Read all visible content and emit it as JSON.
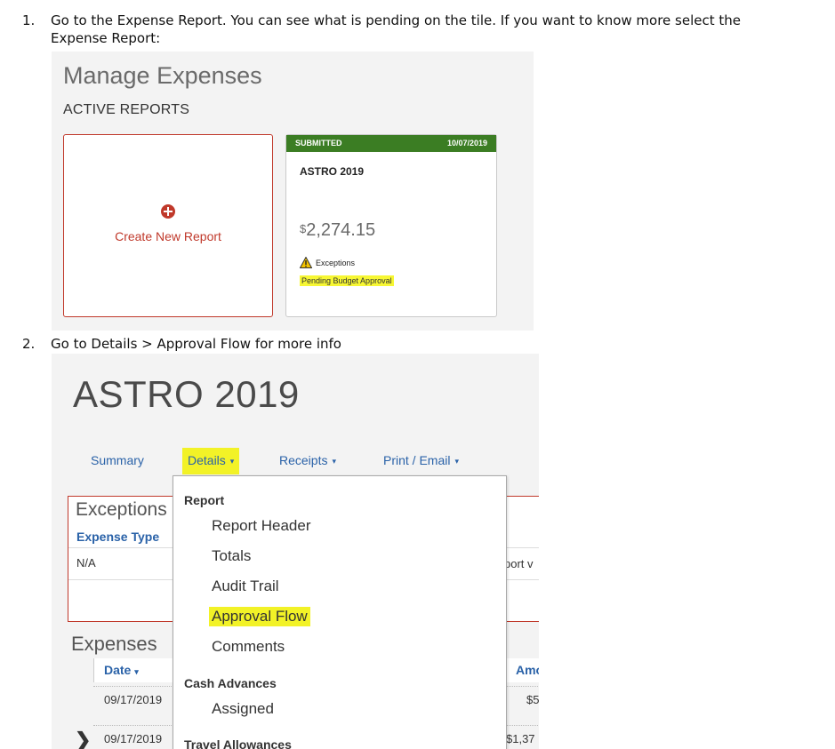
{
  "steps": [
    {
      "num": "1.",
      "text": "Go to the Expense Report. You can see what is pending on the tile. If you want to know more select the",
      "text2": "Expense Report:"
    },
    {
      "num": "2.",
      "text": "Go to Details > Approval Flow for more info"
    }
  ],
  "panel1": {
    "title": "Manage Expenses",
    "subtitle": "ACTIVE REPORTS",
    "create_label": "Create New Report",
    "tile": {
      "status": "SUBMITTED",
      "date": "10/07/2019",
      "name": "ASTRO 2019",
      "currency": "$",
      "amount": "2,274.15",
      "exceptions": "Exceptions",
      "pending": "Pending Budget Approval"
    }
  },
  "panel2": {
    "title": "ASTRO 2019",
    "nav": {
      "summary": "Summary",
      "details": "Details",
      "receipts": "Receipts",
      "print": "Print / Email",
      "caret": "▾"
    },
    "exceptions": {
      "title": "Exceptions",
      "column": "Expense Type",
      "cell": "N/A",
      "right_text": "port v"
    },
    "expenses": {
      "title": "Expenses",
      "col_date": "Date",
      "col_amount": "Amo",
      "rows": [
        {
          "date": "09/17/2019",
          "amount": "$5"
        },
        {
          "date": "09/17/2019",
          "amount": "$1,37"
        }
      ]
    },
    "dropdown": {
      "report_head": "Report",
      "items": [
        "Report Header",
        "Totals",
        "Audit Trail",
        "Approval Flow",
        "Comments"
      ],
      "cash_head": "Cash Advances",
      "cash_items": [
        "Assigned"
      ],
      "travel_head": "Travel Allowances"
    }
  },
  "colors": {
    "accent_red": "#c0392b",
    "submitted_green": "#3b7d23",
    "link_blue": "#2a62a8",
    "highlight_yellow": "#f2f227"
  }
}
